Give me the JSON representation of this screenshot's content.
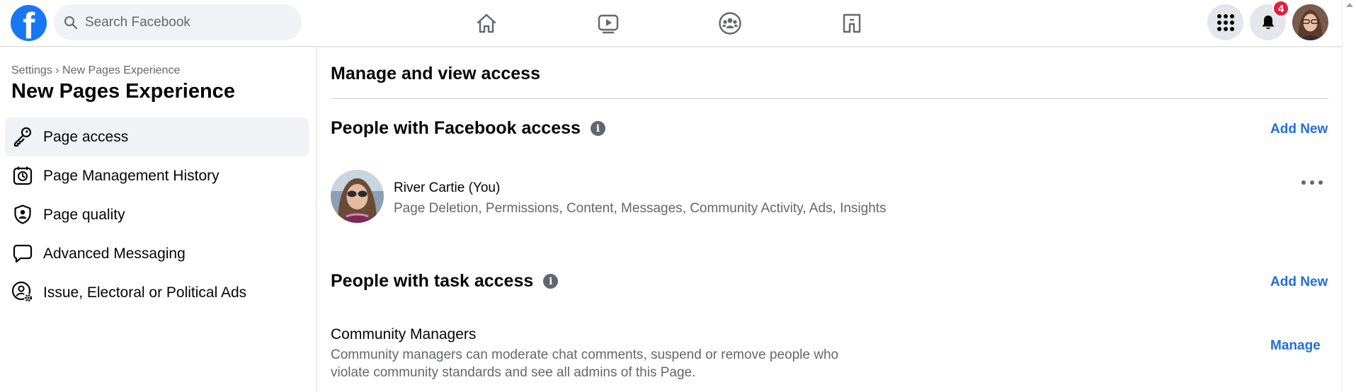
{
  "topbar": {
    "search": {
      "placeholder": "Search Facebook"
    },
    "logo_letter": "f",
    "nav": [
      {
        "name": "home-icon"
      },
      {
        "name": "watch-icon"
      },
      {
        "name": "groups-icon"
      },
      {
        "name": "gaming-icon"
      }
    ],
    "notifications_badge": "4",
    "colors": {
      "brand": "#1877f2",
      "badge": "#e41e3f"
    }
  },
  "sidebar": {
    "breadcrumb": "Settings › New Pages Experience",
    "title": "New Pages Experience",
    "items": [
      {
        "label": "Page access",
        "icon": "key-icon",
        "active": true
      },
      {
        "label": "Page Management History",
        "icon": "history-icon",
        "active": false
      },
      {
        "label": "Page quality",
        "icon": "shield-icon",
        "active": false
      },
      {
        "label": "Advanced Messaging",
        "icon": "chat-bubble-icon",
        "active": false
      },
      {
        "label": "Issue, Electoral or Political Ads",
        "icon": "person-gear-icon",
        "active": false
      }
    ]
  },
  "main": {
    "title": "Manage and view access",
    "facebook_access": {
      "title": "People with Facebook access",
      "add_label": "Add New",
      "person": {
        "name": "River Cartie (You)",
        "permissions": "Page Deletion, Permissions, Content, Messages, Community Activity, Ads, Insights"
      }
    },
    "task_access": {
      "title": "People with task access",
      "add_label": "Add New",
      "community_managers": {
        "title": "Community Managers",
        "description": "Community managers can moderate chat comments, suspend or remove people who violate community standards and see all admins of this Page.",
        "manage_label": "Manage"
      }
    },
    "colors": {
      "link": "#216fdb",
      "secondary_text": "#65676b"
    }
  }
}
